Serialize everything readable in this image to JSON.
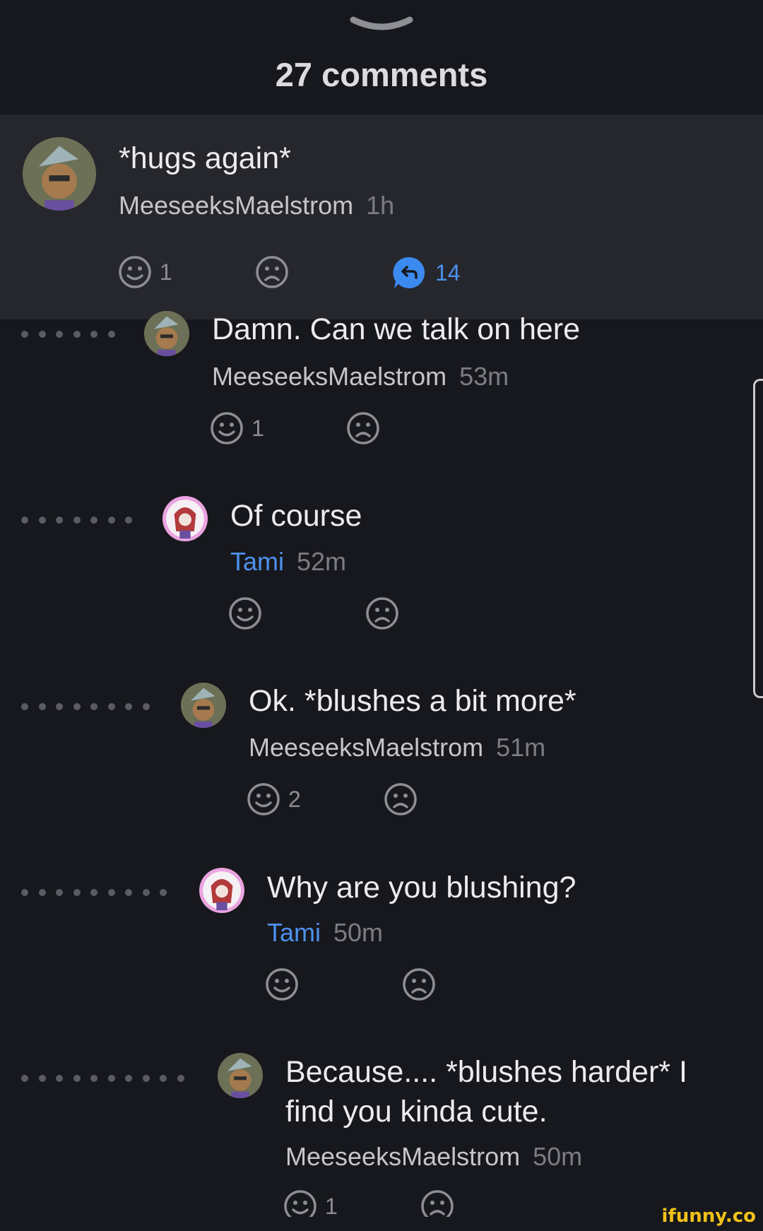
{
  "header": {
    "title": "27 comments"
  },
  "pinned": {
    "text": "*hugs again*",
    "user": "MeeseeksMaelstrom",
    "time": "1h",
    "smile_count": "1",
    "reply_count": "14"
  },
  "replies": [
    {
      "text": "Damn. Can we talk on here",
      "user": "MeeseeksMaelstrom",
      "time": "53m",
      "smile_count": "1"
    },
    {
      "text": "Of course",
      "user": "Tami",
      "time": "52m",
      "smile_count": ""
    },
    {
      "text": "Ok. *blushes a bit more*",
      "user": "MeeseeksMaelstrom",
      "time": "51m",
      "smile_count": "2"
    },
    {
      "text": "Why are you blushing?",
      "user": "Tami",
      "time": "50m",
      "smile_count": ""
    },
    {
      "text_line1": "Because.... *blushes harder* I",
      "text_line2": "find you kinda cute.",
      "user": "MeeseeksMaelstrom",
      "time": "50m",
      "smile_count": "1"
    }
  ],
  "watermark": "ifunny.co",
  "colors": {
    "background": "#17181d",
    "pinned_bg": "#26272d",
    "accent_blue": "#4d92ee",
    "watermark": "#f3c21a"
  }
}
